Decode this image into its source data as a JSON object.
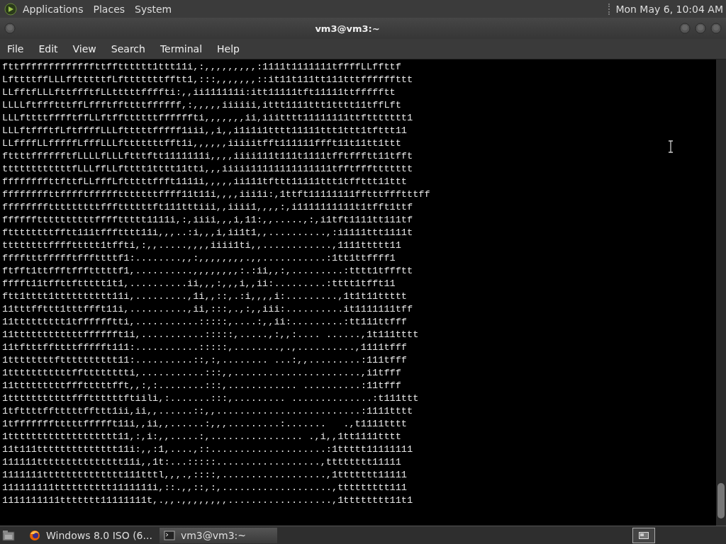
{
  "top_panel": {
    "menus": [
      "Applications",
      "Places",
      "System"
    ],
    "clock": "Mon May  6, 10:04 AM"
  },
  "window": {
    "title": "vm3@vm3:~",
    "menus": [
      "File",
      "Edit",
      "View",
      "Search",
      "Terminal",
      "Help"
    ]
  },
  "terminal": {
    "lines": [
      "fttfffffffffffffttfftttttt1ttt11i,:,,,,,,,,,:1111t1111111tffffLLffttf",
      "LfttttffLLLfftttttfLftttttttfftt1,:::,,,,,,,::it11t111tt111tttffffffttt",
      "LLfftfLLLfttffftfLLtttttffffti:,,ii111111i:itt11111tft11111ttffffftt",
      "LLLLftffftttffLffftffttttffffff,:,,,,,iiiiii,ittt1111ttt1tttt11tffLft",
      "LLLfttttfffftffLLftffttttttffffffti,,,,,,,ii,iiitttt11111111ttfttttttt1",
      "LLLftffftfLftffffLLLftttttfffff1iii,,i,,i1i1i1tttt11111ttt1ttt1tfttt11",
      "LLffffLLfffffLfffLLLftttttttfft1i,,,,,,iiiiitfft111111ffft11t11tt1ttt",
      "fttttfffffftfLLLLfLLLftttftt1111111i,,,,iiii111t111t1111tfftffftt11tfft",
      "ttttttttttttfLLLffLLftttt1tttt11tti,,,iiiii11111111111111tfftfffttttttt",
      "ffffffffttfttfLLfffLftttttffft1111i,,,,,ii111tfttt11111ttt1tffttt11ttt",
      "ffffffffttfffftffffftttttttffff11t11i,,,,iii1i:,1ttft11111111fftttffftttff",
      "fffffffftttttttttfffttttttft111tttiii,,iiii1,,,,:,i1111111111t1tfft1ttf",
      "ffffffttttttttttffffttttt1111i,:,iiii,,,i,11:,,.....,:,i1tft1111tt111tf",
      "fttttttttfftt111tffftttt11i,,,..:i,,,i,ii1t1,,..........,:i1111ttt1111t",
      "ttttttttffffttttt1tffti,:,,.....,,,,iiii1ti,,............,1111ttttt11",
      "fffftttffffftfffttttf1:........,,:,,,,,,,,.,,...........:1tt1ttffff1",
      "ftfft1ttffftffftttttf1,..........,,,,,,,,:.:ii,,:,.........:tttt1tffftt",
      "fffft11tffttfttttt1t1,..........ii,,,:,,,i,,ii:.........:tttt1tfft11",
      "ftt1tttt1tttttttttt11i,.........,1i,,::,.:i,,,,i:.........,1t1t11ttttt",
      "11tttffttt1tttffft11i,..........,ii,:::,.,:,,iii:..........it1111111tff",
      "11ttttttttt1tfffffftti,...........:::::,....:,,ii:.........:tt111ttfff",
      "11ttttttttttttfffffft1i,...........:::::,.....,:,,:.... ......,1t111tttt",
      "11tftttffttttffffft111:...........:::::,........,.,..........,1111tfff",
      "1ttttttttftttttttttt11:..........::,:,........ ...:,,.........:111tfff",
      "1tttttttttttfftttttttti,...........:::,,......................,i1tfff",
      "11tttttttttffftttttfft,,:,:........:::,............ ..........:11tfff",
      "1tttttttttttfffttttttftiili,:.......:::,......... ..............:t111ttt",
      "1tfttttfftttttffttt1ii,ii,,......::,,.........................:1111tttt",
      "1tffffffftttttffffft11i,,ii,,......:,,,.........:.......   .,t1111tttt",
      "1ttttttttttttttttttt11,:,i:,,.....:,................ .,i,,1tt1111tttt",
      "11t111tttttttttttttt11i:,,:1,....,::....................:1ttttt11111111",
      "111111ttttttttttttttt11i,,1t:...:::::..................,tttttttt11111",
      "1111111tttttttttttttt111tttl,,,.,::::,..................,1ttttttt11111",
      "111111111tttttttttt1111111i,::.,,::,:,...................,ttttttttt111",
      "1111111111ttttttt11111111t,.,,.,,,,,,,,..................,1tttttttt11t1"
    ]
  },
  "taskbar": {
    "items": [
      {
        "kind": "browser",
        "label": "Windows 8.0 ISO (6...",
        "selected": false
      },
      {
        "kind": "terminal",
        "label": "vm3@vm3:~",
        "selected": true
      }
    ]
  }
}
